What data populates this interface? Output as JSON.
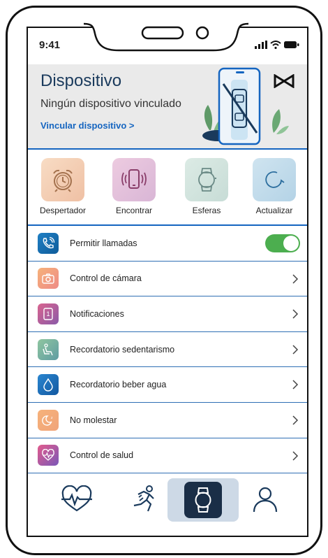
{
  "status_bar": {
    "time": "9:41"
  },
  "header": {
    "title": "Dispositivo",
    "subtitle": "Ningún dispositivo vinculado",
    "link": "Vincular dispositivo >"
  },
  "shortcuts": [
    {
      "label": "Despertador",
      "icon": "alarm-clock-icon",
      "color": "#f3cdb0"
    },
    {
      "label": "Encontrar",
      "icon": "phone-vibrate-icon",
      "color": "#e6c2d6"
    },
    {
      "label": "Esferas",
      "icon": "watch-icon",
      "color": "#cfe2dc"
    },
    {
      "label": "Actualizar",
      "icon": "refresh-icon",
      "color": "#c2d9e8"
    }
  ],
  "settings": {
    "allow_calls": {
      "label": "Permitir llamadas",
      "toggle_on": true,
      "icon": "phone-call-icon"
    },
    "items": [
      {
        "label": "Control de cámara",
        "icon": "camera-icon"
      },
      {
        "label": "Notificaciones",
        "icon": "notification-icon"
      },
      {
        "label": "Recordatorio sedentarismo",
        "icon": "seat-icon"
      },
      {
        "label": "Recordatorio beber agua",
        "icon": "water-drop-icon"
      },
      {
        "label": "No molestar",
        "icon": "moon-icon"
      },
      {
        "label": "Control de salud",
        "icon": "heart-icon"
      }
    ]
  },
  "bottom_nav": [
    {
      "name": "health",
      "icon": "heart-rate-icon",
      "active": false
    },
    {
      "name": "activity",
      "icon": "running-icon",
      "active": false
    },
    {
      "name": "device",
      "icon": "watch-icon",
      "active": true
    },
    {
      "name": "profile",
      "icon": "user-icon",
      "active": false
    }
  ],
  "colors": {
    "accent": "#1565c0",
    "toggle": "#4cae4f",
    "nav_active_bg": "#cdd9e6",
    "nav_active_tile": "#1a2e47"
  }
}
